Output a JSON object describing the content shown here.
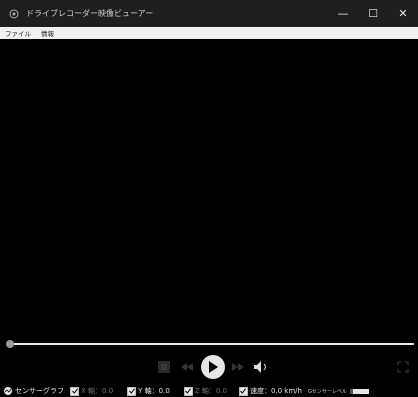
{
  "window": {
    "title": "ドライブレコーダー映像ビューアー",
    "controls": {
      "minimize": "—",
      "maximize": "☐",
      "close": "✕"
    }
  },
  "menu": {
    "items": [
      "ファイル",
      "情報"
    ]
  },
  "player": {
    "seek_progress": 0.0,
    "icons": {
      "stop": "stop-icon",
      "prev": "skip-back-icon",
      "play": "play-icon",
      "next": "skip-forward-icon",
      "volume": "speaker-icon",
      "fullscreen": "fullscreen-icon"
    }
  },
  "status": {
    "sensor_graph": "センサーグラフ",
    "x_axis": "X 軸：0.0",
    "y_axis": "Y 軸：0.0",
    "z_axis": "Z 軸：0.0",
    "speed": "速度：0.0 km/h",
    "g_sensor": "Gセンサーレベル"
  },
  "colors": {
    "titlebar": "#1f1f1f",
    "menubar": "#f0f0f0",
    "video_bg": "#000000"
  }
}
